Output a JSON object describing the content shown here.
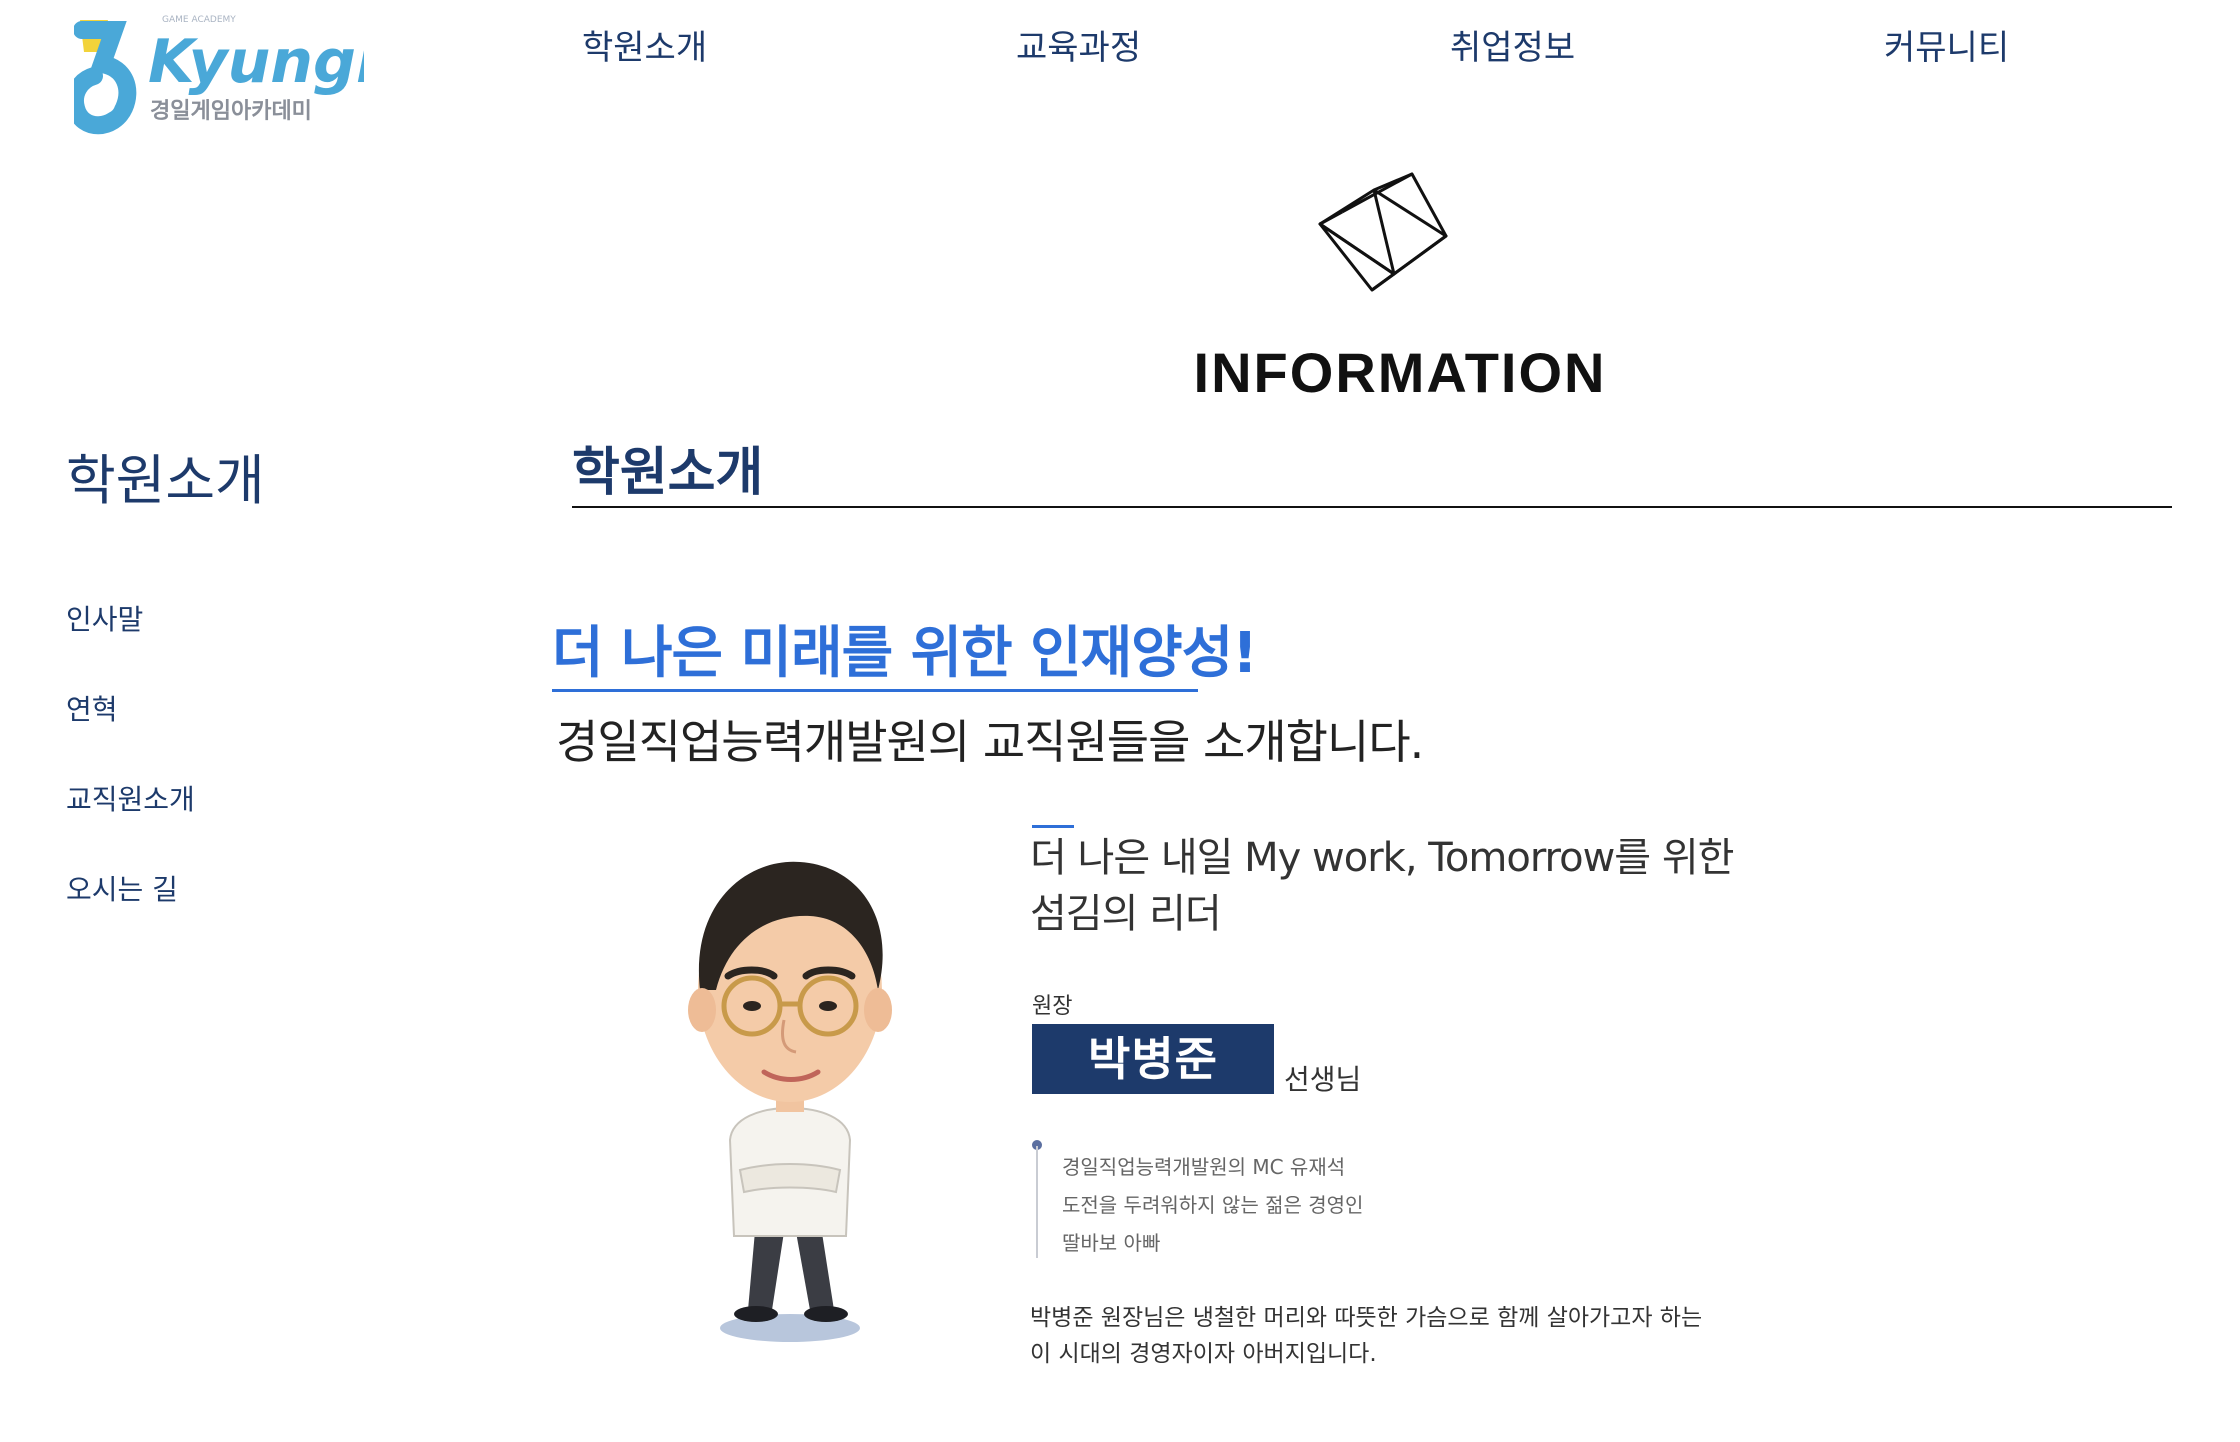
{
  "header": {
    "logo": {
      "brand": "Kyungil",
      "tagline": "GAME ACADEMY",
      "subtitle": "경일게임아카데미"
    },
    "nav": [
      {
        "label": "학원소개"
      },
      {
        "label": "교육과정"
      },
      {
        "label": "취업정보"
      },
      {
        "label": "커뮤니티"
      }
    ]
  },
  "hero": {
    "icon": "cube-icon",
    "title": "INFORMATION"
  },
  "sidebar": {
    "title": "학원소개",
    "items": [
      {
        "label": "인사말"
      },
      {
        "label": "연혁"
      },
      {
        "label": "교직원소개"
      },
      {
        "label": "오시는 길"
      }
    ]
  },
  "main": {
    "title": "학원소개",
    "slogan": "더 나은 미래를 위한 인재양성!",
    "intro": "경일직업능력개발원의 교직원들을 소개합니다.",
    "profile": {
      "motto_line1": "더 나은 내일 My work, Tomorrow를 위한",
      "motto_line2": "섬김의 리더",
      "role": "원장",
      "name": "박병준",
      "honorific": "선생님",
      "traits": [
        "경일직업능력개발원의 MC 유재석",
        "도전을 두려워하지 않는 젊은 경영인",
        "딸바보 아빠"
      ],
      "bio_line1": "박병준 원장님은 냉철한 머리와 따뜻한 가슴으로 함께 살아가고자 하는",
      "bio_line2": "이 시대의 경영자이자 아버지입니다."
    }
  },
  "colors": {
    "navy": "#1d3a6b",
    "accent_blue": "#2e6fd8",
    "logo_blue": "#4aa8d8",
    "logo_yellow": "#f2d33a"
  }
}
